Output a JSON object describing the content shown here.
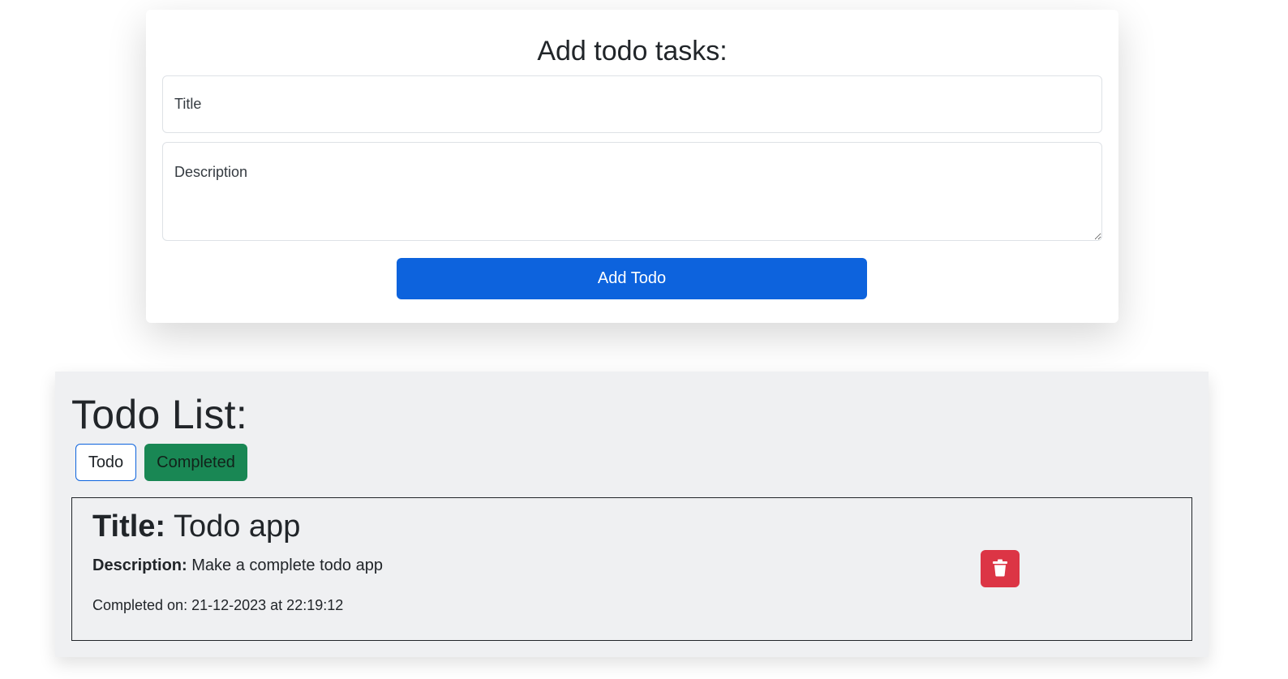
{
  "add_form": {
    "heading": "Add todo tasks:",
    "title_placeholder": "Title",
    "description_placeholder": "Description",
    "submit_label": "Add Todo"
  },
  "todo_list": {
    "heading": "Todo List:",
    "filters": [
      {
        "label": "Todo",
        "active": false
      },
      {
        "label": "Completed",
        "active": true
      }
    ],
    "items": [
      {
        "title_label": "Title:",
        "title": "Todo app",
        "description_label": "Description:",
        "description": "Make a complete todo app",
        "completed_label": "Completed on:",
        "completed_at": "21-12-2023 at 22:19:12",
        "delete_icon": "trash-icon"
      }
    ]
  },
  "colors": {
    "primary": "#0d63dd",
    "success": "#198754",
    "danger": "#dc3545",
    "panel_bg": "#eff0f2"
  }
}
